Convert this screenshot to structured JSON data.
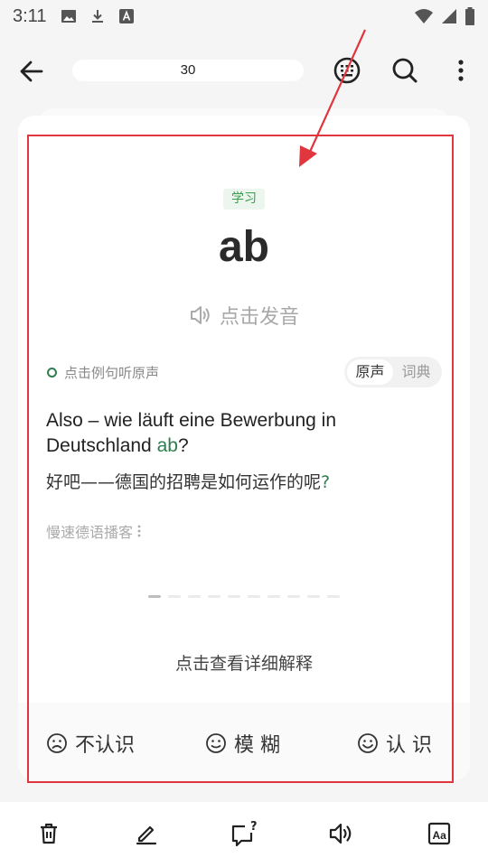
{
  "status_bar": {
    "time": "3:11"
  },
  "header": {
    "counter": "30"
  },
  "card": {
    "tag": "学习",
    "word": "ab",
    "pronounce_label": "点击发音",
    "original_hint": "点击例句听原声",
    "toggle": {
      "options": [
        "原声",
        "词典"
      ],
      "selected": "原声"
    },
    "sentence": {
      "before": "Also – wie läuft eine Bewerbung in Deutschland ",
      "highlight": "ab",
      "after": "?"
    },
    "translation": {
      "text": "好吧——德国的招聘是如何运作的呢",
      "highlight": "?"
    },
    "source": "慢速德语播客",
    "pages": {
      "total": 10,
      "current": 1
    },
    "detail_label": "点击查看详细解释"
  },
  "rating": {
    "dont_know": "不认识",
    "vague": "模 糊",
    "know": "认 识"
  },
  "colors": {
    "accent_green": "#2f7d4e",
    "annotation_red": "#e0363d"
  },
  "bottom_bar": {
    "icons": [
      "trash-icon",
      "edit-icon",
      "feedback-icon",
      "speaker-icon",
      "font-size-icon"
    ]
  }
}
